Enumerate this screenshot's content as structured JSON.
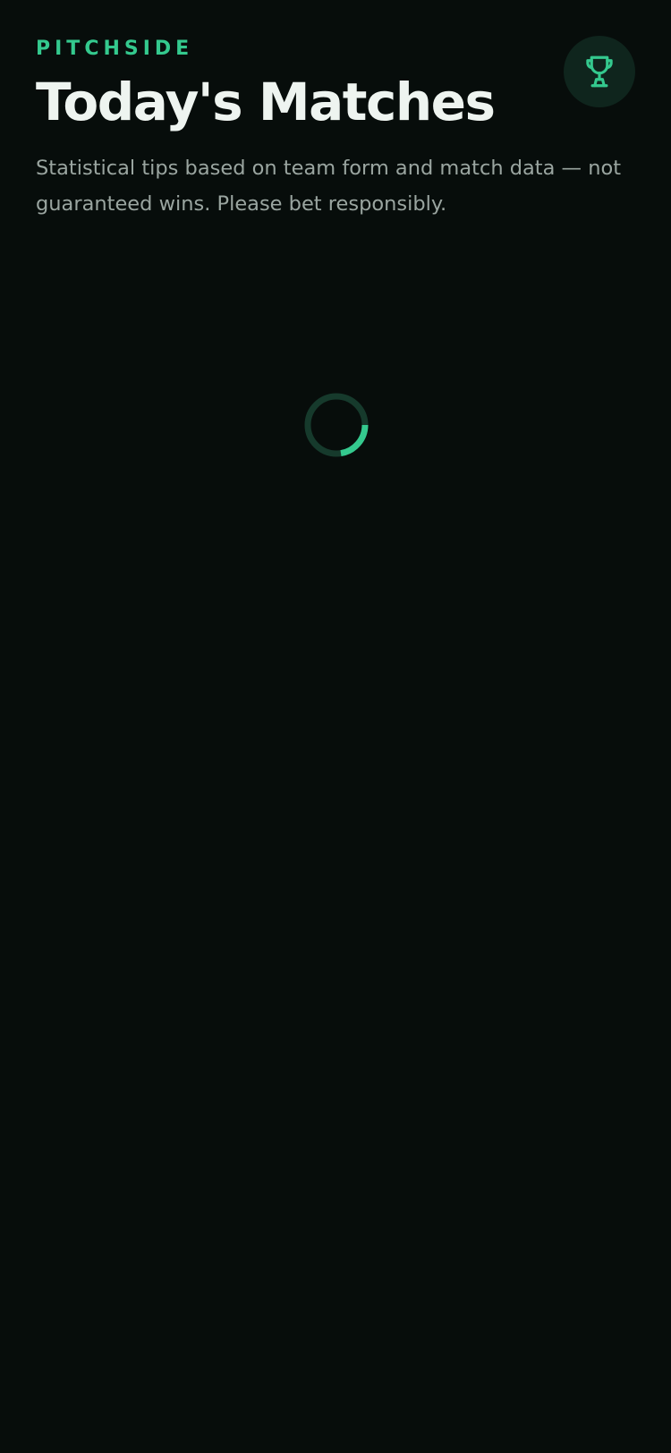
{
  "app": {
    "brand": "PITCHSIDE"
  },
  "header": {
    "title": "Today's Matches",
    "disclaimer": "Statistical tips based on team form and match data — not guaranteed wins. Please bet responsibly."
  },
  "actions": {
    "trophy_icon": "trophy-icon"
  },
  "status": {
    "loading": true,
    "spinner_icon": "loading-spinner-icon"
  },
  "colors": {
    "background": "#070d0b",
    "accent": "#34c98e",
    "title": "#eef4f0",
    "muted_text": "#9aa5a0",
    "button_bg": "#0f251d",
    "spinner_track": "#163a2c"
  }
}
